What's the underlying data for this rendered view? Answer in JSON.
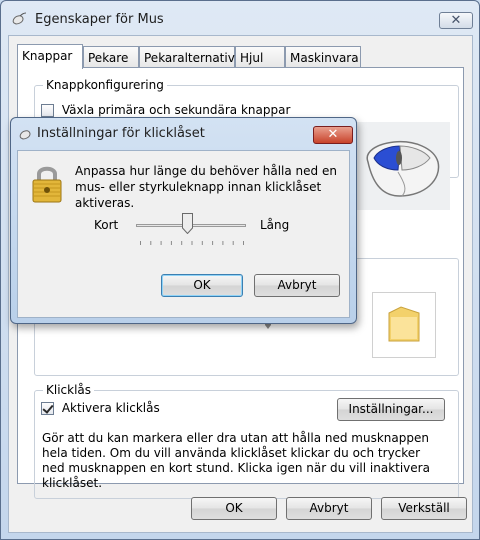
{
  "window": {
    "title": "Egenskaper för Mus",
    "close_label": "✕"
  },
  "tabs": [
    {
      "label": "Knappar",
      "active": true
    },
    {
      "label": "Pekare",
      "active": false
    },
    {
      "label": "Pekaralternativ",
      "active": false
    },
    {
      "label": "Hjul",
      "active": false
    },
    {
      "label": "Maskinvara",
      "active": false
    }
  ],
  "button_config": {
    "legend": "Knappkonfigurering",
    "swap_checkbox_label": "Växla primära och sekundära knappar",
    "swap_checked": false
  },
  "clicklock": {
    "legend": "Klicklås",
    "checkbox_label": "Aktivera klicklås",
    "checked": true,
    "settings_button": "Inställningar...",
    "description": "Gör att du kan markera eller dra utan att hålla ned musknappen hela tiden. Om du vill använda klicklåset klickar du och trycker ned musknappen en kort stund. Klicka igen när du vill inaktivera klicklåset."
  },
  "footer": {
    "ok": "OK",
    "cancel": "Avbryt",
    "apply": "Verkställ"
  },
  "dialog": {
    "title": "Inställningar för klicklåset",
    "close_label": "✕",
    "text": "Anpassa hur länge du behöver hålla ned en mus- eller styrkuleknapp innan klicklåset aktiveras.",
    "slider_min_label": "Kort",
    "slider_max_label": "Lång",
    "slider_value": 0.45,
    "ok": "OK",
    "cancel": "Avbryt"
  },
  "colors": {
    "title_bg": "#c9dbef",
    "accent_blue": "#2b4ed3"
  },
  "icons": [
    "mouse-icon",
    "close-icon",
    "lock-icon",
    "folder-icon",
    "mouse-image"
  ]
}
